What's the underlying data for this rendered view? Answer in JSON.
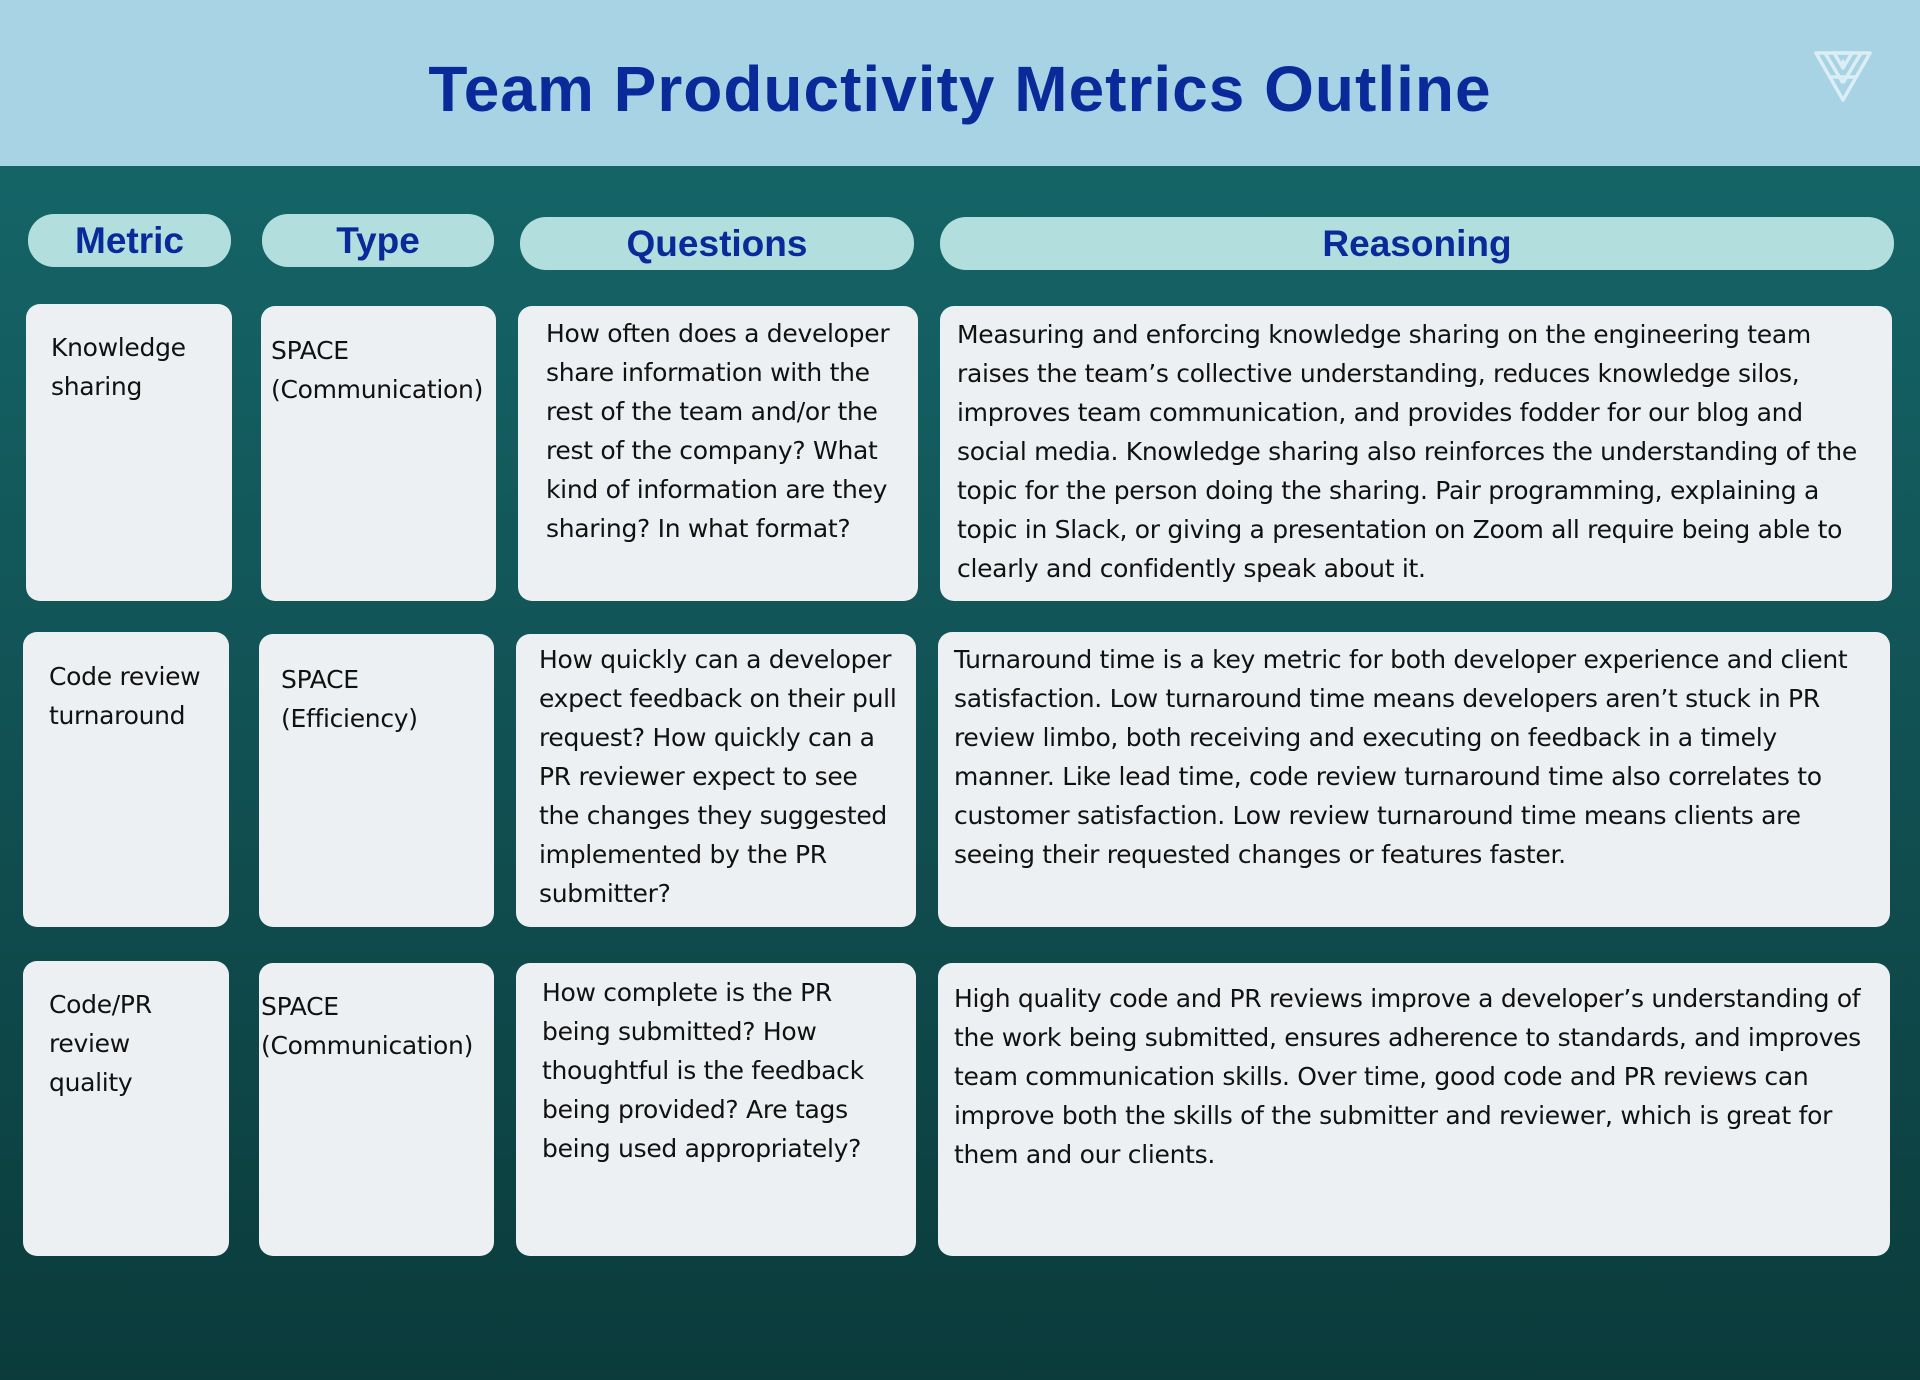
{
  "header": {
    "title": "Team Productivity Metrics Outline",
    "logo_icon": "triangle-logo-icon"
  },
  "columns": [
    {
      "label": "Metric"
    },
    {
      "label": "Type"
    },
    {
      "label": "Questions"
    },
    {
      "label": "Reasoning"
    }
  ],
  "rows": [
    {
      "metric": "Knowledge sharing",
      "type": "SPACE (Communication)",
      "questions": "How often does a developer share information with the rest of the team and/or the rest of the company? What kind of information are they sharing? In what format?",
      "reasoning": "Measuring and enforcing knowledge sharing on the engineering team raises the team’s collective understanding, reduces knowledge silos, improves team communication, and provides fodder for our blog and social media. Knowledge sharing also reinforces the understanding of the topic for the person doing the sharing. Pair programming, explaining a topic in Slack, or giving a presentation on Zoom all require being able to clearly and confidently speak about it."
    },
    {
      "metric": "Code review turnaround",
      "type": "SPACE (Efficiency)",
      "questions": "How quickly can a developer expect feedback on their pull request? How quickly can a PR reviewer expect to see the changes they suggested implemented by the PR submitter?",
      "reasoning": "Turnaround time is a key metric for both developer experience and client satisfaction. Low turnaround time means developers aren’t stuck in PR review limbo, both receiving and executing on feedback in a timely manner. Like lead time, code review turnaround time also correlates to customer satisfaction. Low review turnaround time means clients are seeing their requested changes or features faster."
    },
    {
      "metric": "Code/PR review quality",
      "type": "SPACE (Communication)",
      "questions": "How complete is the PR being submitted? How thoughtful is the feedback being provided? Are tags being used appropriately?",
      "reasoning": "High quality code and PR reviews improve a developer’s understanding of the work being submitted, ensures adherence to standards, and improves team communication skills. Over time, good code and PR reviews can improve both the skills of the submitter and reviewer, which is great for them and our clients."
    }
  ],
  "colors": {
    "header_bg": "#a8d3e5",
    "title": "#0a2a9a",
    "pill_bg": "#b2dede",
    "card_bg": "#edf0f2",
    "body_bg_top": "#156a6c",
    "body_bg_bottom": "#0b3b3b"
  }
}
